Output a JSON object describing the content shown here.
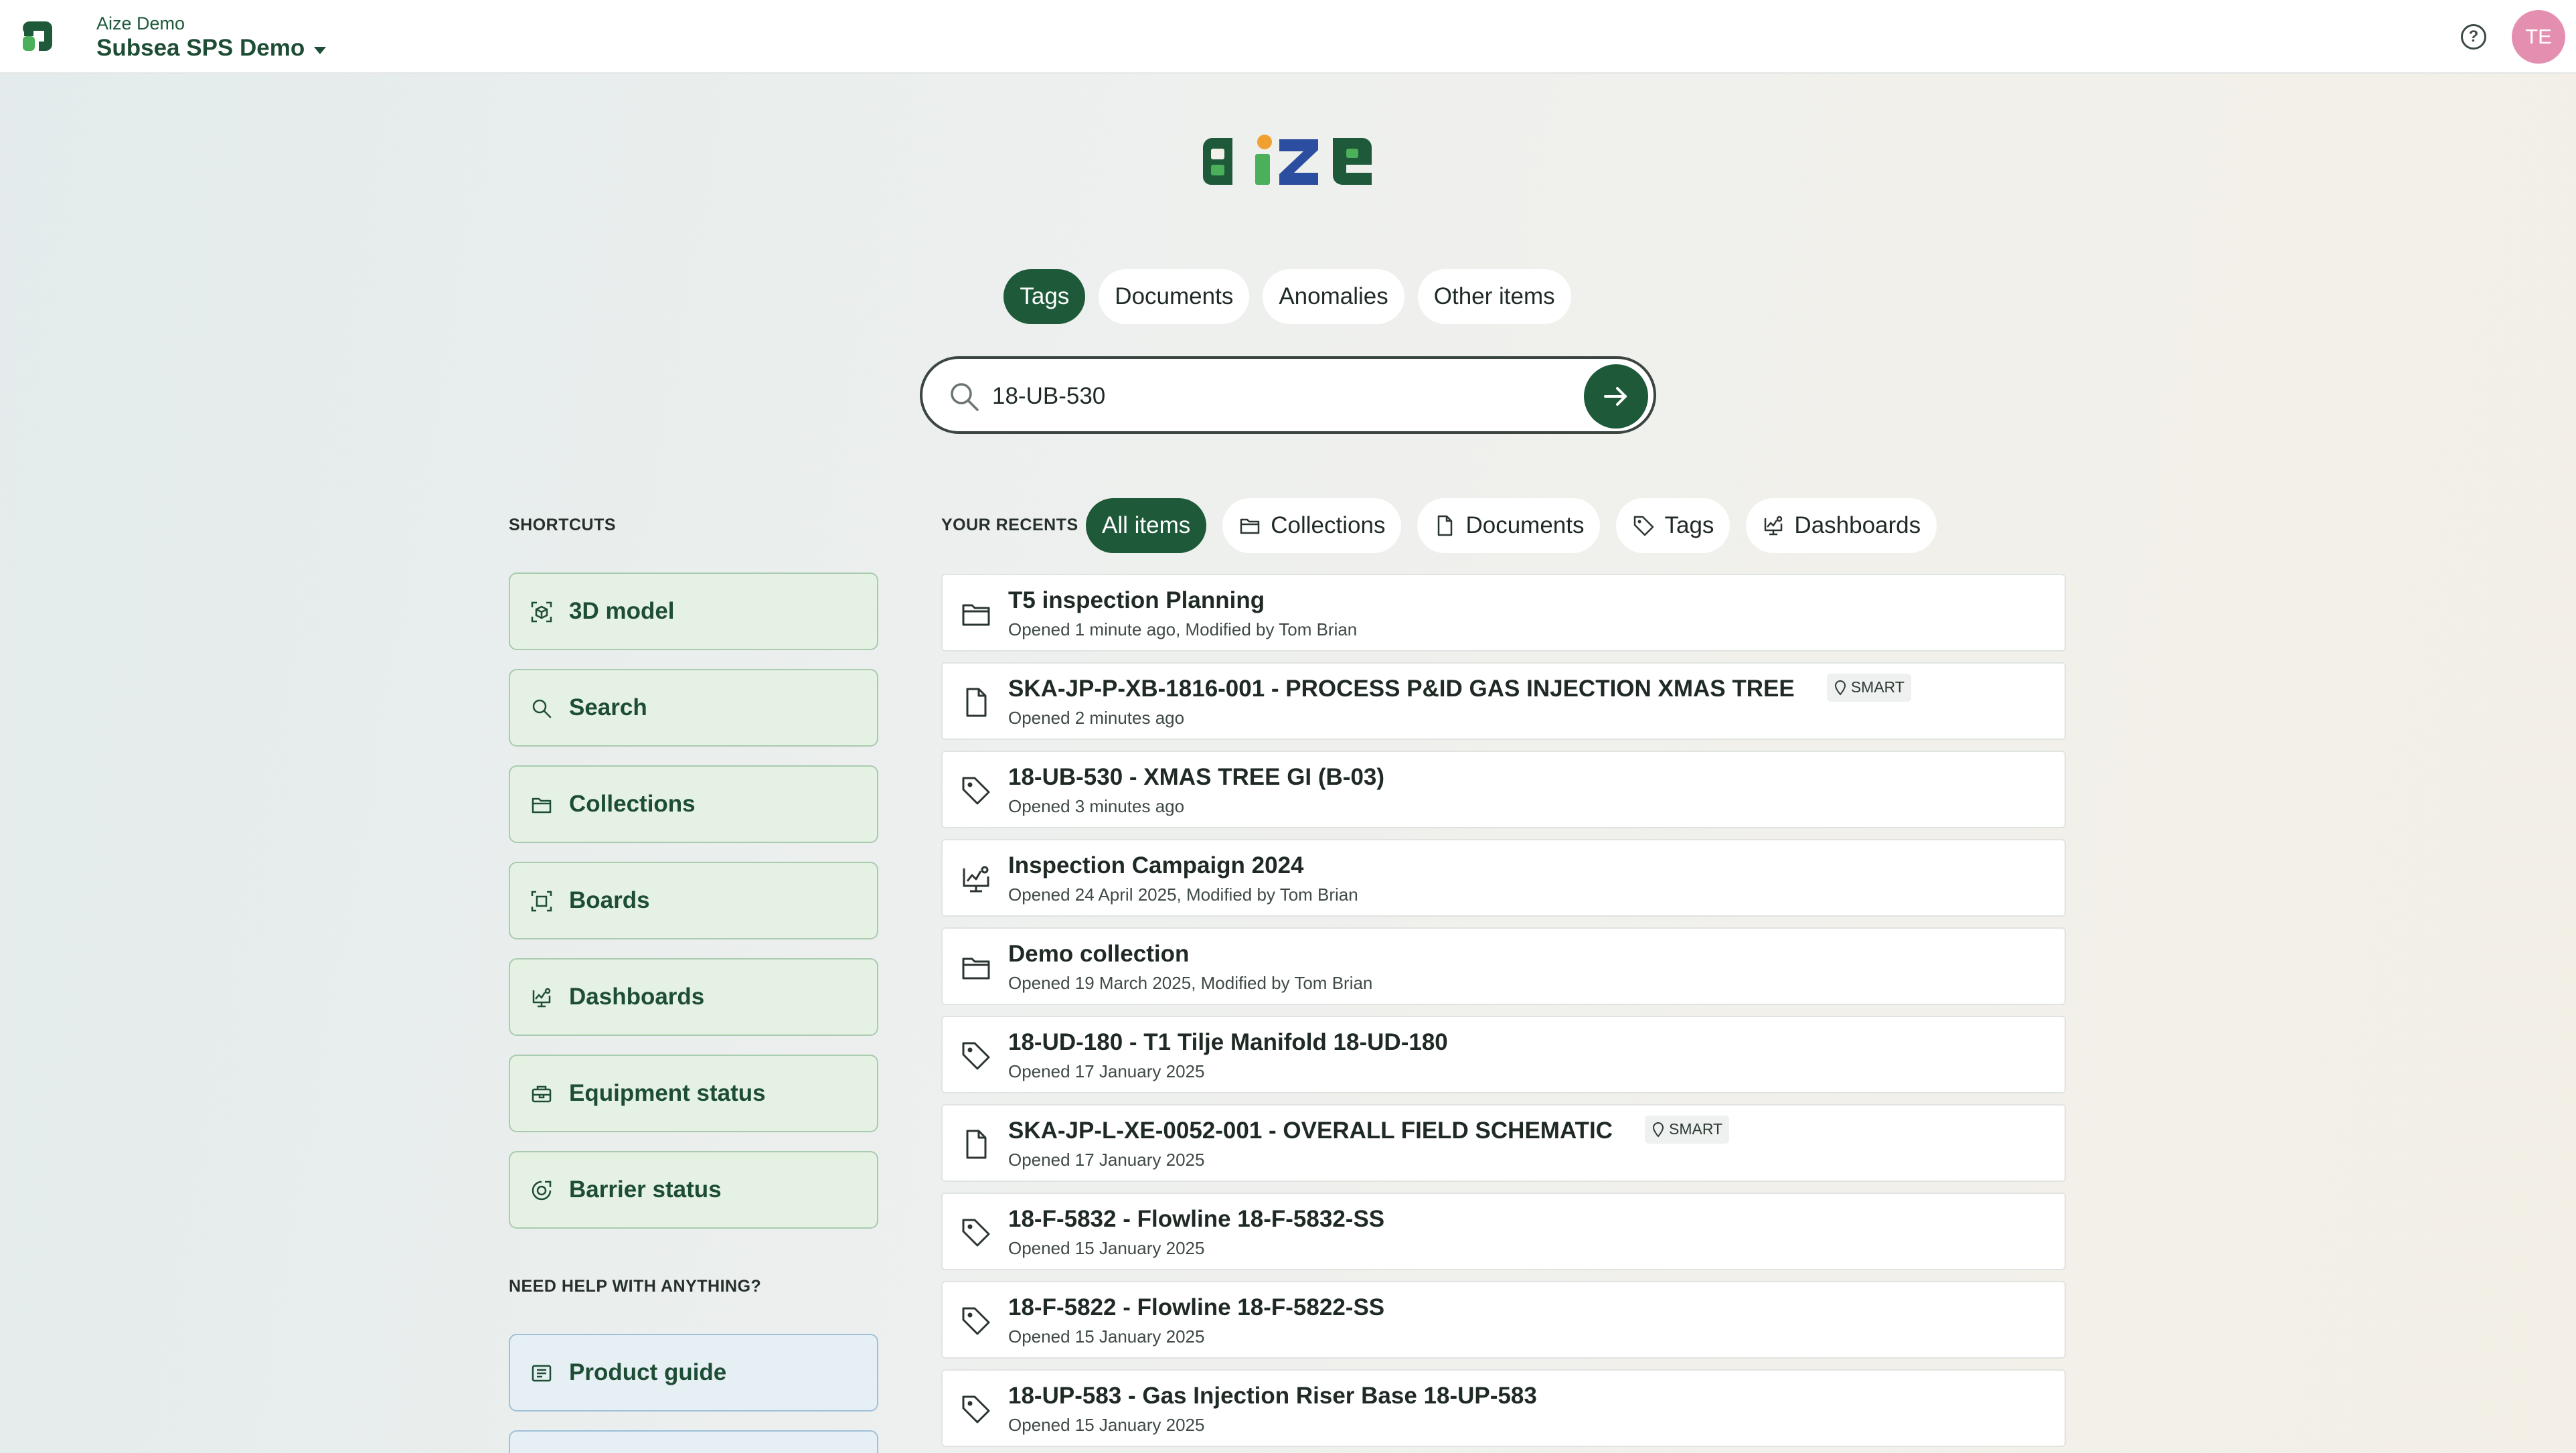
{
  "header": {
    "org_name": "Aize Demo",
    "project_name": "Subsea SPS Demo",
    "help_glyph": "?",
    "user_initials": "TE"
  },
  "search": {
    "types": [
      {
        "label": "Tags",
        "active": true
      },
      {
        "label": "Documents",
        "active": false
      },
      {
        "label": "Anomalies",
        "active": false
      },
      {
        "label": "Other items",
        "active": false
      }
    ],
    "query": "18-UB-530",
    "placeholder": ""
  },
  "shortcuts": {
    "title": "SHORTCUTS",
    "items": [
      {
        "label": "3D model",
        "icon": "3d-model-icon"
      },
      {
        "label": "Search",
        "icon": "search-icon"
      },
      {
        "label": "Collections",
        "icon": "folder-icon"
      },
      {
        "label": "Boards",
        "icon": "board-icon"
      },
      {
        "label": "Dashboards",
        "icon": "dashboard-icon"
      },
      {
        "label": "Equipment status",
        "icon": "equipment-icon"
      },
      {
        "label": "Barrier status",
        "icon": "barrier-icon"
      }
    ]
  },
  "help": {
    "title": "NEED HELP WITH ANYTHING?",
    "items": [
      {
        "label": "Product guide",
        "icon": "guide-icon"
      }
    ]
  },
  "recents": {
    "title": "YOUR RECENTS",
    "filters": [
      {
        "label": "All items",
        "active": true
      },
      {
        "label": "Collections",
        "icon": "folder-icon"
      },
      {
        "label": "Documents",
        "icon": "document-icon"
      },
      {
        "label": "Tags",
        "icon": "tag-icon"
      },
      {
        "label": "Dashboards",
        "icon": "dashboard-icon"
      }
    ],
    "items": [
      {
        "type": "collection",
        "title": "T5 inspection Planning",
        "subtitle": "Opened 1 minute ago, Modified by Tom Brian"
      },
      {
        "type": "document",
        "title": "SKA-JP-P-XB-1816-001 - PROCESS P&ID GAS INJECTION XMAS TREE",
        "subtitle": "Opened 2 minutes ago",
        "badge": "SMART"
      },
      {
        "type": "tag",
        "title": "18-UB-530 - XMAS TREE GI (B-03)",
        "subtitle": "Opened 3 minutes ago"
      },
      {
        "type": "dashboard",
        "title": "Inspection Campaign 2024",
        "subtitle": "Opened 24 April 2025, Modified by Tom Brian"
      },
      {
        "type": "collection",
        "title": "Demo collection",
        "subtitle": "Opened 19 March 2025, Modified by Tom Brian"
      },
      {
        "type": "tag",
        "title": "18-UD-180 - T1 Tilje Manifold 18-UD-180",
        "subtitle": "Opened 17 January 2025"
      },
      {
        "type": "document",
        "title": "SKA-JP-L-XE-0052-001 - OVERALL FIELD SCHEMATIC",
        "subtitle": "Opened 17 January 2025",
        "badge": "SMART"
      },
      {
        "type": "tag",
        "title": "18-F-5832 - Flowline 18-F-5832-SS",
        "subtitle": "Opened 15 January 2025"
      },
      {
        "type": "tag",
        "title": "18-F-5822 - Flowline 18-F-5822-SS",
        "subtitle": "Opened 15 January 2025"
      },
      {
        "type": "tag",
        "title": "18-UP-583 - Gas Injection Riser Base 18-UP-583",
        "subtitle": "Opened 15 January 2025"
      }
    ]
  },
  "colors": {
    "brand_green": "#1e5a3a",
    "shortcut_bg": "#e5f1e3",
    "help_bg": "#e6eff3",
    "avatar": "#e58fb0"
  }
}
